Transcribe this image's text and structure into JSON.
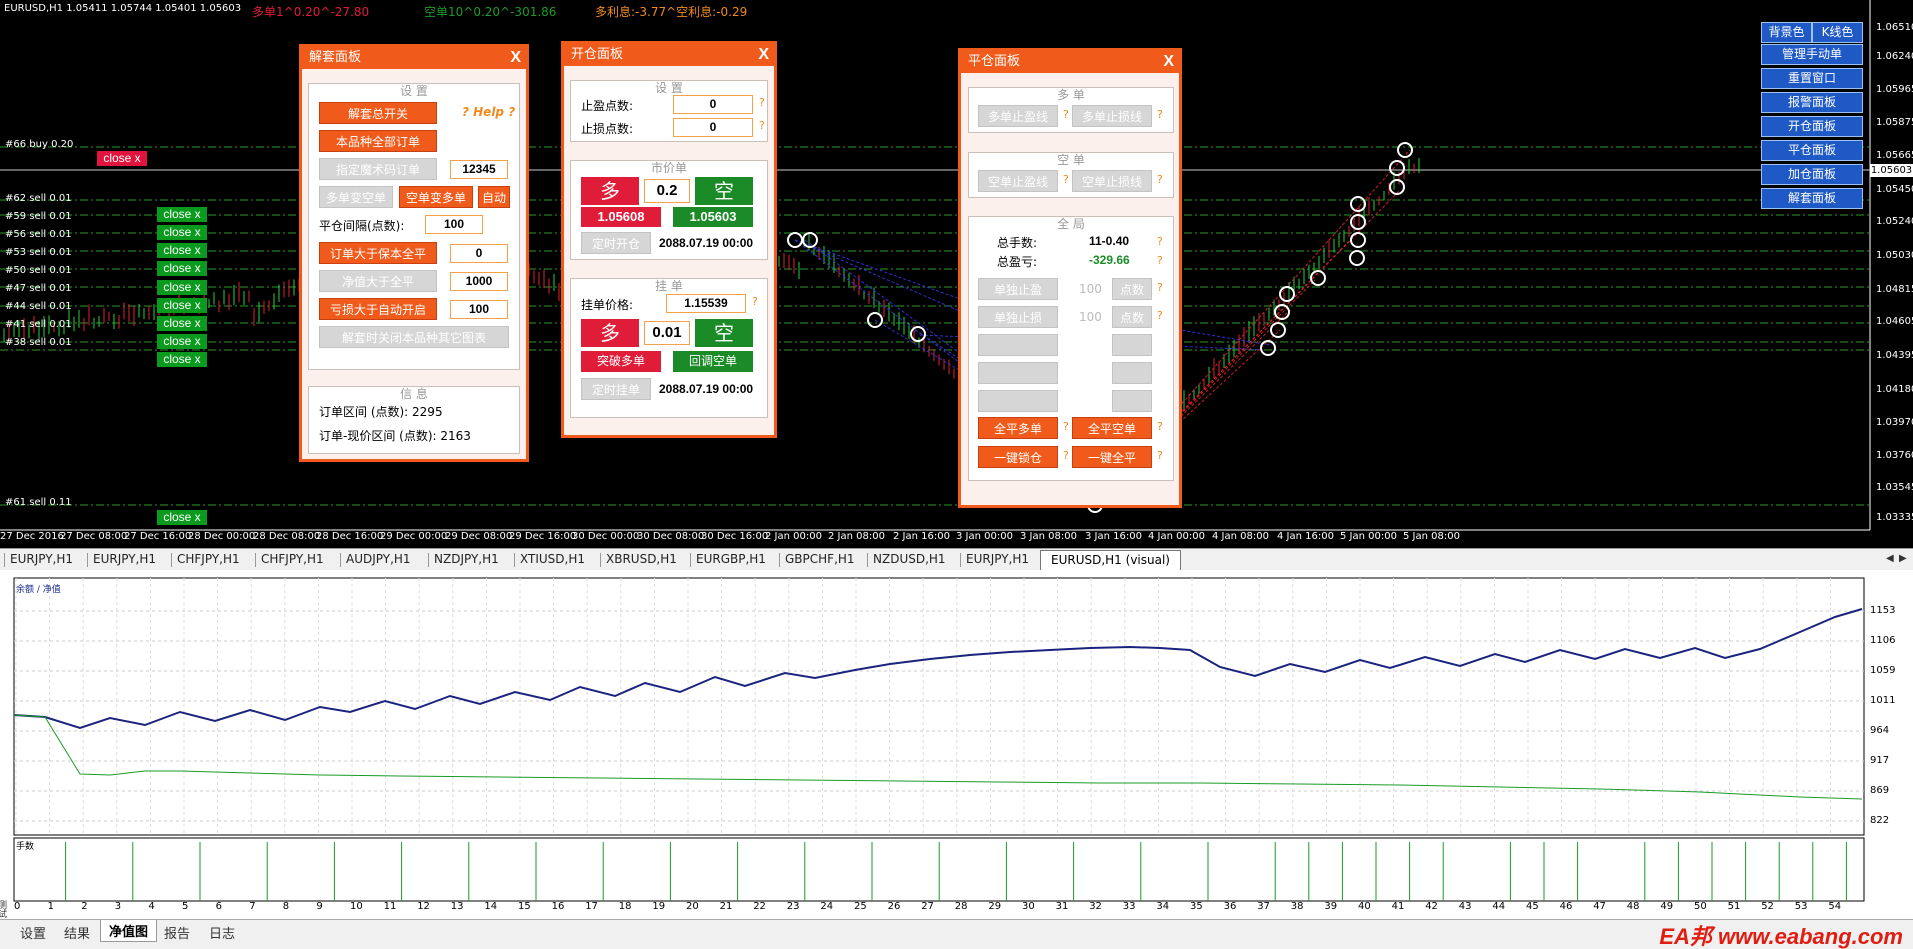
{
  "chart": {
    "header_symbol": "EURUSD,H1  1.05411 1.05744 1.05401 1.05603",
    "long_info": "多单1^0.20^-27.80",
    "short_info": "空单10^0.20^-301.86",
    "swap_info": "多利息:-3.77^空利息:-0.29",
    "price_labels": [
      "1.06510",
      "1.06240",
      "1.05965",
      "1.05875",
      "1.05665",
      "1.05603",
      "1.05450",
      "1.05240",
      "1.05030",
      "1.04815",
      "1.04605",
      "1.04395",
      "1.04180",
      "1.03970",
      "1.03760",
      "1.03545",
      "1.03335"
    ],
    "time_labels": [
      "27 Dec 2016",
      "27 Dec 08:00",
      "27 Dec 16:00",
      "28 Dec 00:00",
      "28 Dec 08:00",
      "28 Dec 16:00",
      "29 Dec 00:00",
      "29 Dec 08:00",
      "29 Dec 16:00",
      "30 Dec 00:00",
      "30 Dec 08:00",
      "30 Dec 16:00",
      "2 Jan 00:00",
      "2 Jan 08:00",
      "2 Jan 16:00",
      "3 Jan 00:00",
      "3 Jan 08:00",
      "3 Jan 16:00",
      "4 Jan 00:00",
      "4 Jan 08:00",
      "4 Jan 16:00",
      "5 Jan 00:00",
      "5 Jan 08:00"
    ],
    "level_labels": [
      "#66 buy 0.20",
      "#62 sell 0.01",
      "#59 sell 0.01",
      "#56 sell 0.01",
      "#53 sell 0.01",
      "#50 sell 0.01",
      "#47 sell 0.01",
      "#44 sell 0.01",
      "#41 sell 0.01",
      "#38 sell 0.01",
      "#61 sell 0.11"
    ],
    "close_label": "close x"
  },
  "panel_unwind": {
    "title": "解套面板",
    "close": "X",
    "settings_title": "设 置",
    "master_switch": "解套总开关",
    "help": "? Help ?",
    "all_orders": "本品种全部订单",
    "magic_orders": "指定魔术码订单",
    "magic_value": "12345",
    "long_to_short": "多单变空单",
    "short_to_long": "空单变多单",
    "auto": "自动",
    "interval_label": "平仓间隔(点数):",
    "interval_value": "100",
    "order_breakeven": "订单大于保本全平",
    "order_breakeven_value": "0",
    "equity_close": "净值大于全平",
    "equity_value": "1000",
    "loss_reopen": "亏损大于自动开启",
    "loss_value": "100",
    "close_other": "解套时关闭本品种其它图表",
    "info_title": "信 息",
    "range_line": "订单区间 (点数): 2295",
    "range_now_line": "订单-现价区间 (点数): 2163"
  },
  "panel_open": {
    "title": "开仓面板",
    "close": "X",
    "settings_title": "设 置",
    "tp_label": "止盈点数:",
    "tp_value": "0",
    "sl_label": "止损点数:",
    "sl_value": "0",
    "market_title": "市价单",
    "buy": "多",
    "lot": "0.2",
    "sell": "空",
    "bid": "1.05608",
    "ask": "1.05603",
    "timed_open": "定时开仓",
    "timed_open_value": "2088.07.19 00:00",
    "pending_title": "挂 单",
    "pending_label": "挂单价格:",
    "pending_value": "1.15539",
    "buy2": "多",
    "lot2": "0.01",
    "sell2": "空",
    "breakout_buy": "突破多单",
    "pullback_sell": "回调空单",
    "timed_pending": "定时挂单",
    "timed_pending_value": "2088.07.19 00:00",
    "q": "?"
  },
  "panel_close": {
    "title": "平仓面板",
    "close": "X",
    "long_title": "多 单",
    "long_tp": "多单止盈线",
    "long_sl": "多单止损线",
    "short_title": "空 单",
    "short_tp": "空单止盈线",
    "short_sl": "空单止损线",
    "global_title": "全 局",
    "lots_label": "总手数:",
    "lots_value": "11-0.40",
    "pnl_label": "总盈亏:",
    "pnl_value": "-329.66",
    "single_tp": "单独止盈",
    "single_tp_val": "100",
    "points": "点数",
    "single_sl": "单独止损",
    "single_sl_val": "100",
    "close_all_long": "全平多单",
    "close_all_short": "全平空单",
    "lock": "一键锁仓",
    "close_all": "一键全平",
    "q": "?"
  },
  "controls": {
    "bg_color": "背景色",
    "k_color": "K线色",
    "items": [
      "管理手动单",
      "重置窗口",
      "报警面板",
      "开仓面板",
      "平仓面板",
      "加仓面板",
      "解套面板"
    ]
  },
  "tabs": [
    "EURJPY,H1",
    "EURJPY,H1",
    "CHFJPY,H1",
    "CHFJPY,H1",
    "AUDJPY,H1",
    "NZDJPY,H1",
    "XTIUSD,H1",
    "XBRUSD,H1",
    "EURGBP,H1",
    "GBPCHF,H1",
    "NZDUSD,H1",
    "EURJPY,H1"
  ],
  "active_tab": "EURUSD,H1 (visual)",
  "tester": {
    "legend": "余额 / 净值",
    "lots_legend": "手数",
    "y_labels": [
      "1153",
      "1106",
      "1059",
      "1011",
      "964",
      "917",
      "869",
      "822"
    ],
    "x_labels": [
      "0",
      "1",
      "2",
      "3",
      "4",
      "5",
      "6",
      "7",
      "8",
      "9",
      "10",
      "11",
      "12",
      "13",
      "14",
      "15",
      "16",
      "17",
      "18",
      "19",
      "20",
      "21",
      "22",
      "23",
      "24",
      "25",
      "26",
      "27",
      "28",
      "29",
      "30",
      "31",
      "32",
      "33",
      "34",
      "35",
      "36",
      "37",
      "38",
      "39",
      "40",
      "41",
      "42",
      "43",
      "44",
      "45",
      "46",
      "47",
      "48",
      "49",
      "50",
      "51",
      "52",
      "53",
      "54"
    ],
    "side_label": "测试器"
  },
  "bottom_tabs": [
    "设置",
    "结果",
    "净值图",
    "报告",
    "日志"
  ],
  "bottom_active": "净值图",
  "watermark": "EA邦 www.eabang.com",
  "colors": {
    "accent": "#f05a1a",
    "buy": "#e01d38",
    "sell": "#1a8b26",
    "blue": "#1e59c6"
  }
}
